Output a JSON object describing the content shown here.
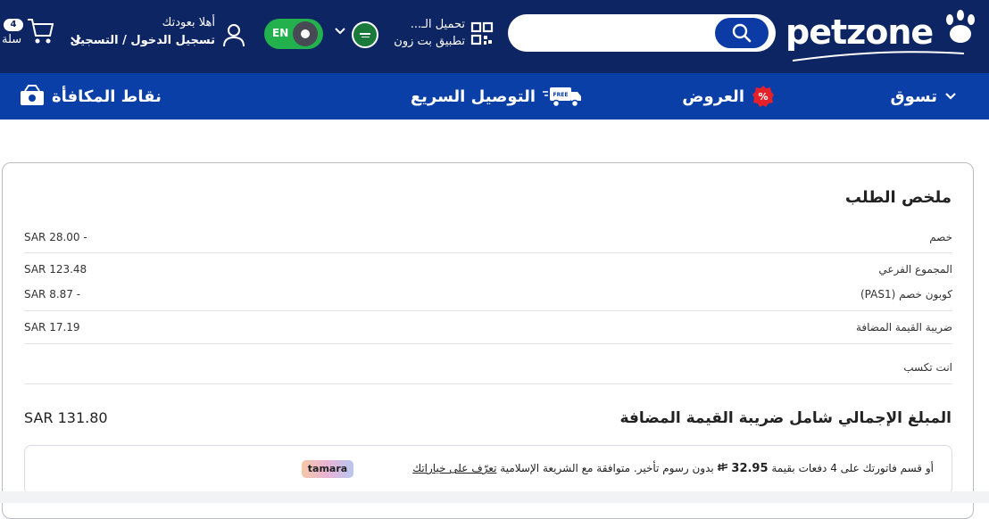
{
  "header": {
    "logo_text": "petzone",
    "search": {
      "placeholder": ""
    },
    "app_download": {
      "line1": "تحميل الـ...",
      "line2": "تطبيق بت زون"
    },
    "language_toggle": {
      "label": "EN"
    },
    "account": {
      "greeting": "أهلا بعودتك",
      "login_label": "تسجيل الدخول / التسجيل"
    },
    "cart": {
      "count": "4",
      "label": "سلة"
    }
  },
  "nav": {
    "shop": "تسوق",
    "offers": "العروض",
    "delivery": "التوصيل السريع",
    "delivery_badge": "FREE",
    "rewards": "نقاط المكافأة"
  },
  "summary": {
    "title": "ملخص الطلب",
    "rows": [
      {
        "label": "خصم",
        "value": "SAR  28.00 -"
      },
      {
        "label": "المجموع الفرعي",
        "value": "SAR  123.48"
      },
      {
        "label": "كوبون خصم (PAS1)",
        "value": "SAR  8.87 -"
      },
      {
        "label": "ضريبة القيمة المضافة",
        "value": "SAR  17.19"
      },
      {
        "label": "انت تكسب",
        "value": ""
      }
    ],
    "total_label": "المبلغ الإجمالي شامل ضريبة القيمة المضافة",
    "total_value": "SAR  131.80",
    "tamara": {
      "text_before": "أو قسم فاتورتك على 4 دفعات بقيمة",
      "amount": "32.95",
      "text_after": "بدون رسوم تأخير. متوافقة مع الشريعة الإسلامية",
      "link": "تعرّف على خياراتك",
      "logo": "tamara"
    }
  },
  "colors": {
    "header_bg": "#0d2563",
    "nav_bg": "#0a3fa8",
    "toggle_green": "#22b14c",
    "search_btn": "#0d3ba6"
  }
}
